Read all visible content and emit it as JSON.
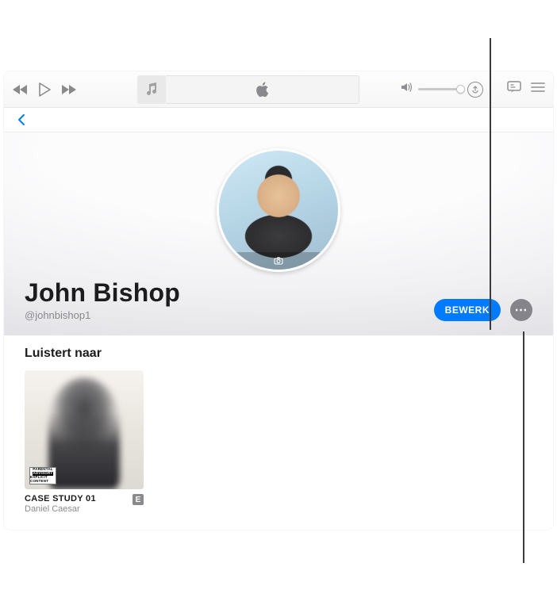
{
  "profile": {
    "display_name": "John Bishop",
    "handle": "@johnbishop1",
    "edit_label": "BEWERK"
  },
  "sections": {
    "listening_title": "Luistert naar"
  },
  "albums": [
    {
      "title": "CASE STUDY 01",
      "artist": "Daniel Caesar",
      "explicit_badge": "E",
      "parental_line1": "PARENTAL",
      "parental_line2": "ADVISORY",
      "parental_line3": "EXPLICIT CONTENT"
    }
  ],
  "icons": {
    "more": "⋯"
  }
}
